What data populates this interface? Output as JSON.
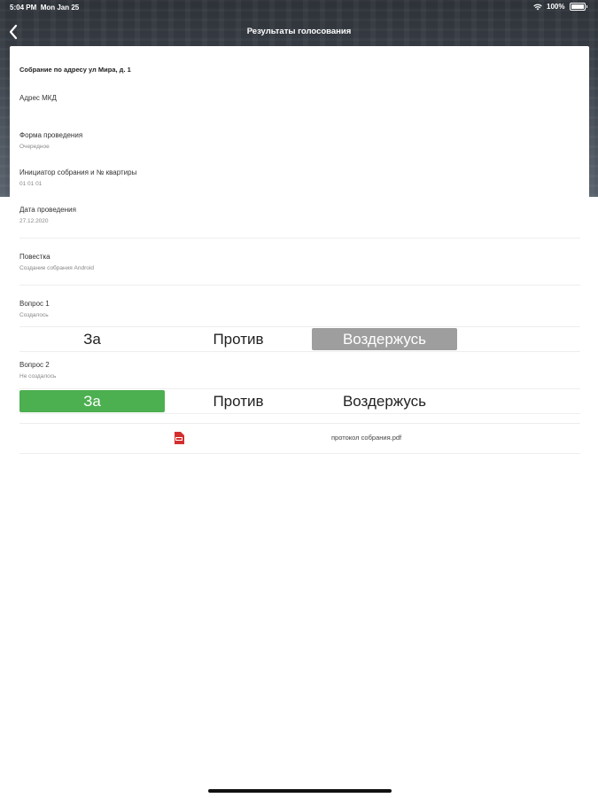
{
  "status": {
    "time": "5:04 PM",
    "date": "Mon Jan 25",
    "battery": "100%"
  },
  "nav": {
    "title": "Результаты голосования"
  },
  "meeting": {
    "title": "Собрание по адресу ул Мира, д. 1",
    "address_label": "Адрес МКД",
    "form_label": "Форма проведения",
    "form_value": "Очередное",
    "initiator_label": "Инициатор собрания и № квартиры",
    "initiator_value": "01 01 01",
    "date_label": "Дата проведения",
    "date_value": "27.12.2020",
    "agenda_label": "Повестка",
    "agenda_value": "Создание собрания Android"
  },
  "questions": [
    {
      "label": "Вопрос 1",
      "status": "Создалось",
      "options": [
        "За",
        "Против",
        "Воздержусь"
      ],
      "selected": "Воздержусь"
    },
    {
      "label": "Вопрос 2",
      "status": "Не создалось",
      "options": [
        "За",
        "Против",
        "Воздержусь"
      ],
      "selected": "За"
    }
  ],
  "attachment": {
    "name": "протокол собрания.pdf"
  },
  "colors": {
    "selected_gray": "#9e9e9e",
    "selected_green": "#4caf50"
  }
}
